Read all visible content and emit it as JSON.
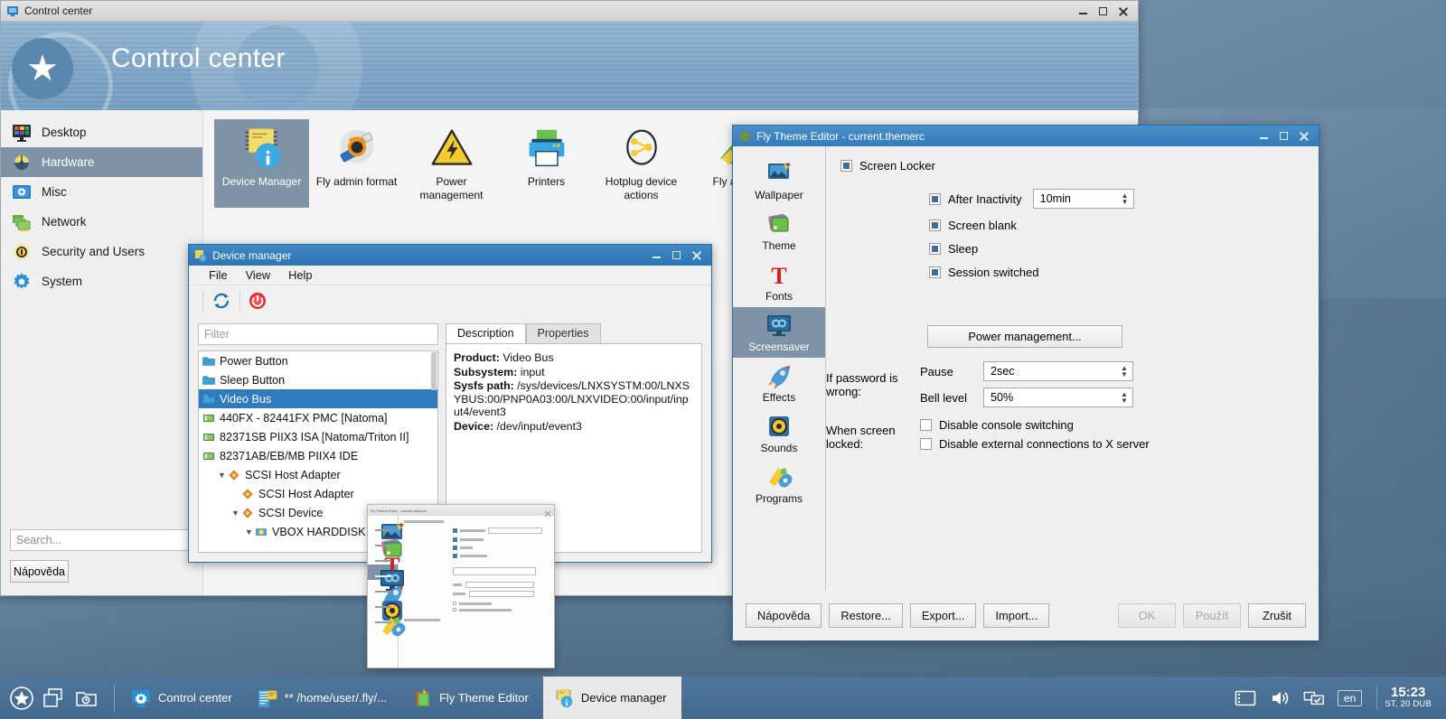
{
  "desktop": {
    "taskbar": {
      "launchers": [
        {
          "name": "start-menu",
          "icon": "star-circle-icon"
        },
        {
          "name": "show-desktop",
          "icon": "windows-cascade-icon"
        },
        {
          "name": "workspace-switcher",
          "icon": "folder-clock-icon"
        }
      ],
      "tasks": [
        {
          "label": "Control center",
          "icon": "control-center-icon",
          "active": false
        },
        {
          "label": "** /home/user/.fly/...",
          "icon": "text-editor-icon",
          "active": false
        },
        {
          "label": "Fly Theme Editor",
          "icon": "theme-editor-icon",
          "active": false
        },
        {
          "label": "Device manager",
          "icon": "device-manager-icon",
          "active": true
        }
      ],
      "tray": [
        {
          "name": "terminal-icon"
        },
        {
          "name": "volume-icon"
        },
        {
          "name": "network-icon"
        }
      ],
      "keyboard_layout": "en",
      "clock_time": "15:23",
      "clock_date": "ST, 20 DUB"
    }
  },
  "control_center": {
    "window_title": "Control center",
    "banner_title": "Control center",
    "titlebar_buttons": [
      "minimize",
      "maximize",
      "close"
    ],
    "sidebar": {
      "items": [
        {
          "label": "Desktop",
          "icon": "desktop-icon",
          "selected": false
        },
        {
          "label": "Hardware",
          "icon": "hardware-icon",
          "selected": true
        },
        {
          "label": "Misc",
          "icon": "misc-icon",
          "selected": false
        },
        {
          "label": "Network",
          "icon": "network-icon",
          "selected": false
        },
        {
          "label": "Security and Users",
          "icon": "security-icon",
          "selected": false
        },
        {
          "label": "System",
          "icon": "system-gear-icon",
          "selected": false
        }
      ],
      "search_placeholder": "Search...",
      "help_button": "Nápověda"
    },
    "tiles": [
      {
        "label": "Device Manager",
        "icon": "device-manager-icon",
        "selected": true
      },
      {
        "label": "Fly admin format",
        "icon": "usb-format-icon",
        "selected": false
      },
      {
        "label": "Power management",
        "icon": "power-warning-icon",
        "selected": false
      },
      {
        "label": "Printers",
        "icon": "printer-icon",
        "selected": false
      },
      {
        "label": "Hotplug device actions",
        "icon": "hotplug-icon",
        "selected": false
      },
      {
        "label": "Fly admin",
        "icon": "fly-admin-icon",
        "selected": false
      }
    ]
  },
  "device_manager": {
    "window_title": "Device manager",
    "menu": [
      "File",
      "View",
      "Help"
    ],
    "toolbar": [
      {
        "name": "refresh-button",
        "icon": "refresh-icon"
      },
      {
        "name": "power-button",
        "icon": "power-icon"
      }
    ],
    "filter_placeholder": "Filter",
    "tree": [
      {
        "label": "Power Button",
        "depth": 0,
        "icon": "folder-icon",
        "arrow": "",
        "selected": false
      },
      {
        "label": "Sleep Button",
        "depth": 0,
        "icon": "folder-icon",
        "arrow": "",
        "selected": false
      },
      {
        "label": "Video Bus",
        "depth": 0,
        "icon": "folder-icon",
        "arrow": "",
        "selected": true
      },
      {
        "label": "440FX - 82441FX PMC [Natoma]",
        "depth": 0,
        "icon": "chip-icon",
        "arrow": "",
        "selected": false
      },
      {
        "label": "82371SB PIIX3 ISA [Natoma/Triton II]",
        "depth": 0,
        "icon": "chip-icon",
        "arrow": "",
        "selected": false
      },
      {
        "label": "82371AB/EB/MB PIIX4 IDE",
        "depth": 0,
        "icon": "chip-icon",
        "arrow": "",
        "selected": false
      },
      {
        "label": "SCSI Host Adapter",
        "depth": 1,
        "icon": "diamond-icon",
        "arrow": "v",
        "selected": false
      },
      {
        "label": "SCSI Host Adapter",
        "depth": 2,
        "icon": "diamond-icon",
        "arrow": "",
        "selected": false
      },
      {
        "label": "SCSI Device",
        "depth": 2,
        "icon": "diamond-icon",
        "arrow": "v",
        "selected": false
      },
      {
        "label": "VBOX HARDDISK",
        "depth": 3,
        "icon": "disk-icon",
        "arrow": "v",
        "selected": false
      }
    ],
    "tabs": [
      {
        "label": "Description",
        "active": true
      },
      {
        "label": "Properties",
        "active": false
      }
    ],
    "description": [
      {
        "key": "Product:",
        "value": " Video Bus"
      },
      {
        "key": "Subsystem:",
        "value": " input"
      },
      {
        "key": "Sysfs path:",
        "value": " /sys/devices/LNXSYSTM:00/LNXSYBUS:00/PNP0A03:00/LNXVIDEO:00/input/input4/event3"
      },
      {
        "key": "Device:",
        "value": " /dev/input/event3"
      }
    ]
  },
  "theme_editor": {
    "window_title": "Fly Theme Editor - current.themerc",
    "sidebar": [
      {
        "label": "Wallpaper",
        "icon": "wallpaper-icon",
        "selected": false
      },
      {
        "label": "Theme",
        "icon": "theme-icon",
        "selected": false
      },
      {
        "label": "Fonts",
        "icon": "fonts-icon",
        "selected": false
      },
      {
        "label": "Screensaver",
        "icon": "screensaver-icon",
        "selected": true
      },
      {
        "label": "Effects",
        "icon": "effects-rocket-icon",
        "selected": false
      },
      {
        "label": "Sounds",
        "icon": "sounds-icon",
        "selected": false
      },
      {
        "label": "Programs",
        "icon": "programs-icon",
        "selected": false
      }
    ],
    "screen_locker": {
      "label": "Screen Locker",
      "state": "partial"
    },
    "options": [
      {
        "label": "After Inactivity",
        "state": "partial",
        "value": "10min",
        "has_spin": true
      },
      {
        "label": "Screen blank",
        "state": "partial",
        "has_spin": false
      },
      {
        "label": "Sleep",
        "state": "partial",
        "has_spin": false
      },
      {
        "label": "Session switched",
        "state": "partial",
        "has_spin": false
      }
    ],
    "power_management_button": "Power management...",
    "password_group_label": "If password is wrong:",
    "pause_label": "Pause",
    "pause_value": "2sec",
    "bell_label": "Bell level",
    "bell_value": "50%",
    "locked_group_label": "When screen locked:",
    "locked_options": [
      {
        "label": "Disable console switching",
        "state": "empty"
      },
      {
        "label": "Disable external connections to X server",
        "state": "empty"
      }
    ],
    "footer_buttons": [
      {
        "label": "Nápověda",
        "disabled": false
      },
      {
        "label": "Restore...",
        "disabled": false
      },
      {
        "label": "Export...",
        "disabled": false
      },
      {
        "label": "Import...",
        "disabled": false
      },
      {
        "label": "OK",
        "disabled": true
      },
      {
        "label": "Použít",
        "disabled": true
      },
      {
        "label": "Zrušit",
        "disabled": false
      }
    ]
  },
  "preview_thumbnail": {
    "name": "fly-theme-editor-preview",
    "title": "Fly Theme Editor - current.themerc"
  },
  "colors": {
    "selection_blue": "#2f7bc0",
    "selection_grey_blue": "#7e93a6",
    "titlebar_blue": "#337cb9",
    "taskbar_blue": "#4f749a",
    "checkbox_fill": "#3c6e9f"
  }
}
